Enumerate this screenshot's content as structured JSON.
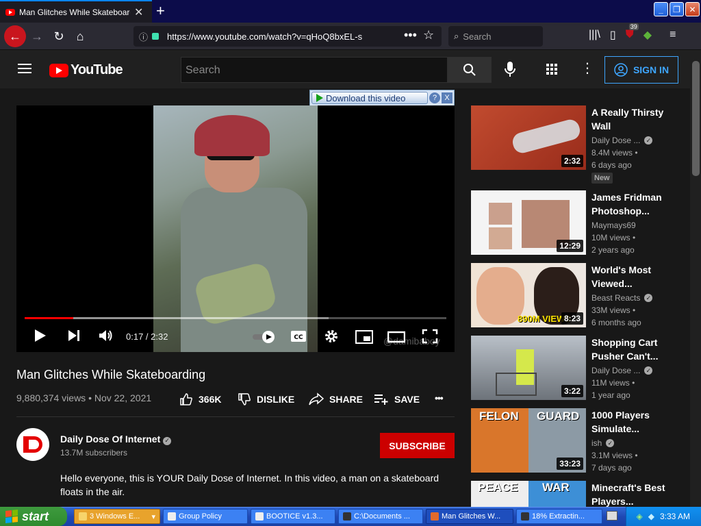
{
  "browser": {
    "tab_title": "Man Glitches While Skateboarding",
    "url_prefix": "https://www.",
    "url_domain": "youtube.com",
    "url_path": "/watch?v=qHoQ8bxEL-s",
    "search_placeholder": "Search",
    "library_badge": "39"
  },
  "yt": {
    "logo_text": "YouTube",
    "search_placeholder": "Search",
    "signin_label": "SIGN IN"
  },
  "download_bar": {
    "label": "Download this video",
    "help": "?",
    "close": "X"
  },
  "player": {
    "time": "0:17 / 2:32",
    "watermark": "@damibaboy",
    "progress": {
      "played_pct": 11.5,
      "buffered_pct": 72
    }
  },
  "video": {
    "title": "Man Glitches While Skateboarding",
    "meta": "9,880,374 views • Nov 22, 2021",
    "likes": "366K",
    "dislike": "DISLIKE",
    "share": "SHARE",
    "save": "SAVE",
    "more": "•••"
  },
  "channel": {
    "name": "Daily Dose Of Internet",
    "subscribers": "13.7M subscribers",
    "subscribe_label": "SUBSCRIBE",
    "description": "Hello everyone, this is YOUR Daily Dose of Internet. In this video, a man on a skateboard floats in the air."
  },
  "related": [
    {
      "title": "A Really Thirsty Wall",
      "channel": "Daily Dose ...",
      "verified": true,
      "views": "8.4M views •",
      "age": "6 days ago",
      "duration": "2:32",
      "badge": "New",
      "thumb_bg": "#b13a27"
    },
    {
      "title": "James Fridman Photoshop...",
      "channel": "Maymays69",
      "verified": false,
      "views": "10M views •",
      "age": "2 years ago",
      "duration": "12:29",
      "thumb_bg": "#f2f2f2"
    },
    {
      "title": "World's Most Viewed...",
      "channel": "Beast Reacts",
      "verified": true,
      "views": "33M views •",
      "age": "6 months ago",
      "duration": "8:23",
      "thumb_text": "890M VIEWS",
      "thumb_bg": "#e9e0d6"
    },
    {
      "title": "Shopping Cart Pusher Can't...",
      "channel": "Daily Dose ...",
      "verified": true,
      "views": "11M views •",
      "age": "1 year ago",
      "duration": "3:22",
      "thumb_bg": "#8d9299"
    },
    {
      "title": "1000 Players Simulate...",
      "channel": "ish",
      "verified": true,
      "views": "3.1M views •",
      "age": "7 days ago",
      "duration": "33:23",
      "thumb_text_left": "FELON",
      "thumb_text_right": "GUARD",
      "thumb_bg": "#d9762b"
    },
    {
      "title": "Minecraft's Best Players...",
      "thumb_text_left": "PEACE",
      "thumb_text_right": "WAR",
      "thumb_bg": "#3d8fd6"
    }
  ],
  "taskbar": {
    "start": "start",
    "items": [
      {
        "label": "3 Windows E..."
      },
      {
        "label": "Group Policy"
      },
      {
        "label": "BOOTICE v1.3..."
      },
      {
        "label": "C:\\Documents ..."
      },
      {
        "label": "Man Glitches W..."
      },
      {
        "label": "18% Extractin..."
      }
    ],
    "clock": "3:33 AM"
  },
  "colors": {
    "yt_red": "#ff0000",
    "subscribe_red": "#cc0000",
    "link_blue": "#3ea6ff",
    "xp_blue": "#1f48b3"
  }
}
